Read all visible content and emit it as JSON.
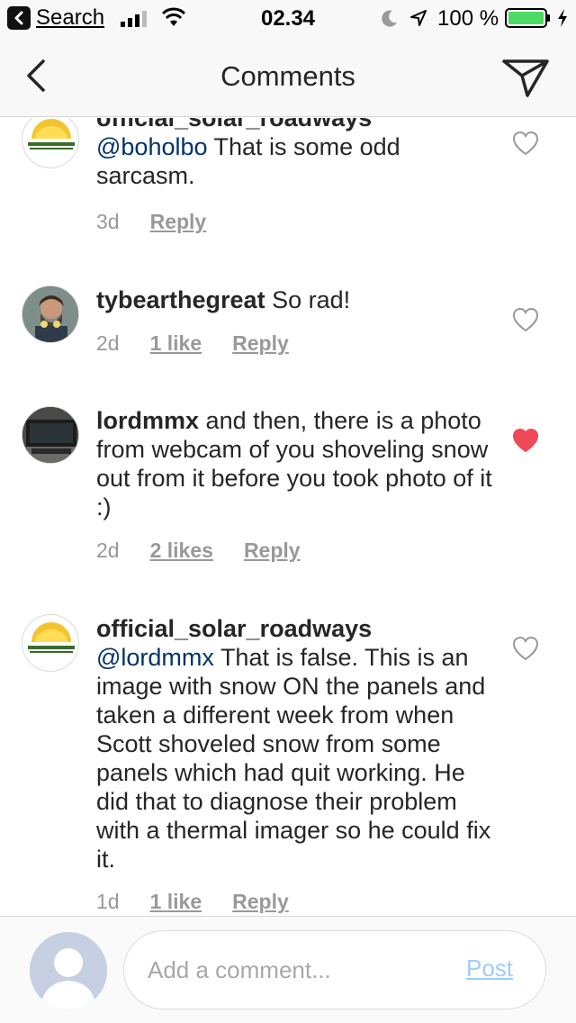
{
  "status_bar": {
    "back_label": "Search",
    "time": "02.34",
    "battery": "100 %"
  },
  "header": {
    "title": "Comments"
  },
  "comments": [
    {
      "username": "official_solar_roadways",
      "mention": "@boholbo",
      "text": "That is some odd sarcasm.",
      "age": "3d",
      "likes": "",
      "reply": "Reply",
      "liked": false,
      "avatar_brand": "SOLAR ROADWAYS"
    },
    {
      "username": "tybearthegreat",
      "mention": "",
      "text": "So rad!",
      "age": "2d",
      "likes": "1 like",
      "reply": "Reply",
      "liked": false
    },
    {
      "username": "lordmmx",
      "mention": "",
      "text": "and then, there is a photo from webcam of you shoveling snow out from it before you took photo of it :)",
      "age": "2d",
      "likes": "2 likes",
      "reply": "Reply",
      "liked": true
    },
    {
      "username": "official_solar_roadways",
      "mention": "@lordmmx",
      "text": "That is false. This is an image with snow ON the panels and taken a different week from when Scott shoveled snow from some panels which had quit working. He did that to diagnose their problem with a thermal imager so he could fix it.",
      "age": "1d",
      "likes": "1 like",
      "reply": "Reply",
      "liked": false,
      "avatar_brand": "SOLAR ROADWAYS"
    }
  ],
  "footer": {
    "placeholder": "Add a comment...",
    "post_label": "Post"
  },
  "colors": {
    "mention": "#003569",
    "heart_liked": "#ed4956",
    "post_disabled": "#9fcdf6",
    "battery": "#4cd964"
  },
  "icons": [
    "back-app-icon",
    "signal-icon",
    "wifi-icon",
    "moon-icon",
    "location-icon",
    "battery-icon",
    "charge-icon",
    "back-arrow-icon",
    "direct-message-icon",
    "heart-icon",
    "user-silhouette-icon"
  ]
}
